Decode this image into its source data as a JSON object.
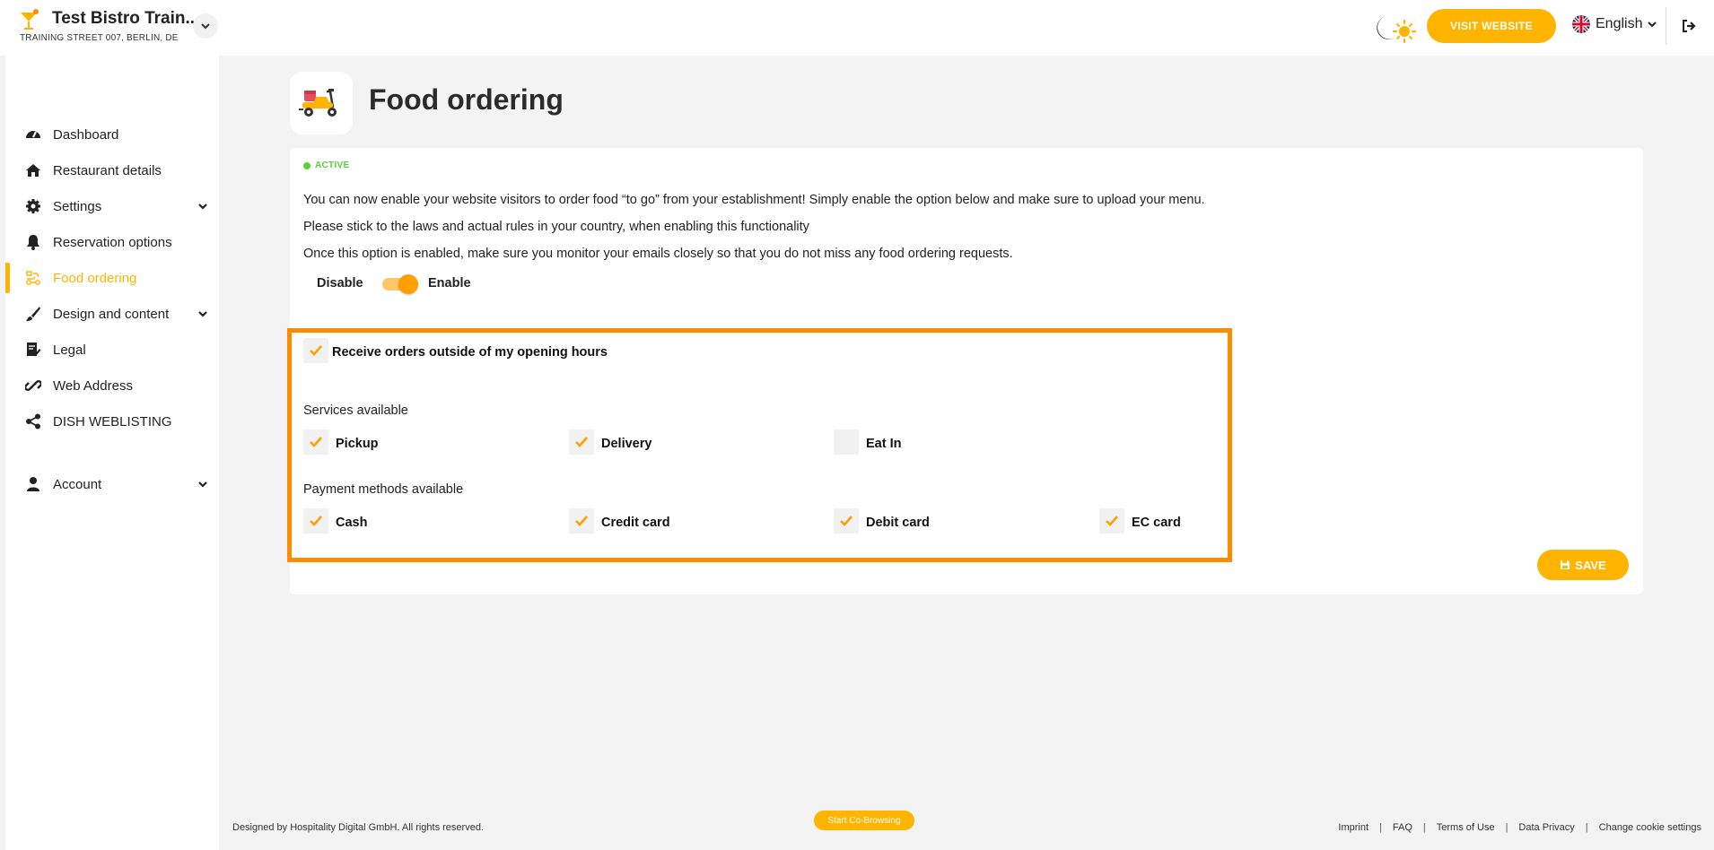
{
  "header": {
    "restaurant_name": "Test Bistro Train..",
    "address": "TRAINING STREET 007, BERLIN, DE",
    "visit_website": "VISIT WEBSITE",
    "language": "English"
  },
  "sidebar": {
    "items": [
      {
        "label": "Dashboard",
        "icon": "dashboard-icon"
      },
      {
        "label": "Restaurant details",
        "icon": "home-icon"
      },
      {
        "label": "Settings",
        "icon": "gear-icon",
        "expandable": true
      },
      {
        "label": "Reservation options",
        "icon": "bell-icon"
      },
      {
        "label": "Food ordering",
        "icon": "food-ordering-icon",
        "active": true
      },
      {
        "label": "Design and content",
        "icon": "brush-icon",
        "expandable": true
      },
      {
        "label": "Legal",
        "icon": "legal-icon"
      },
      {
        "label": "Web Address",
        "icon": "link-icon"
      },
      {
        "label": "DISH WEBLISTING",
        "icon": "share-icon"
      },
      {
        "label": "Account",
        "icon": "user-icon",
        "expandable": true
      }
    ]
  },
  "page": {
    "title": "Food ordering",
    "status": "ACTIVE",
    "paragraphs": [
      "You can now enable your website visitors to order food “to go” from your establishment! Simply enable the option below and make sure to upload your menu.",
      "Please stick to the laws and actual rules in your country, when enabling this functionality",
      "Once this option is enabled, make sure you monitor your emails closely so that you do not miss any food ordering requests."
    ],
    "toggle": {
      "off_label": "Disable",
      "on_label": "Enable",
      "enabled": true
    },
    "outside_hours": {
      "label": "Receive orders outside of my opening hours",
      "checked": true
    },
    "services": {
      "title": "Services available",
      "options": [
        {
          "label": "Pickup",
          "checked": true
        },
        {
          "label": "Delivery",
          "checked": true
        },
        {
          "label": "Eat In",
          "checked": false
        }
      ]
    },
    "payments": {
      "title": "Payment methods available",
      "options": [
        {
          "label": "Cash",
          "checked": true
        },
        {
          "label": "Credit card",
          "checked": true
        },
        {
          "label": "Debit card",
          "checked": true
        },
        {
          "label": "EC card",
          "checked": true
        }
      ]
    },
    "save_label": "SAVE"
  },
  "footer": {
    "copyright": "Designed by Hospitality Digital GmbH. All rights reserved.",
    "cobrowse": "Start Co-Browsing",
    "links": [
      "Imprint",
      "FAQ",
      "Terms of Use",
      "Data Privacy",
      "Change cookie settings"
    ]
  },
  "colors": {
    "accent": "#ffb400",
    "active_status": "#5ccf3a",
    "highlight_border": "#ff8c00"
  }
}
